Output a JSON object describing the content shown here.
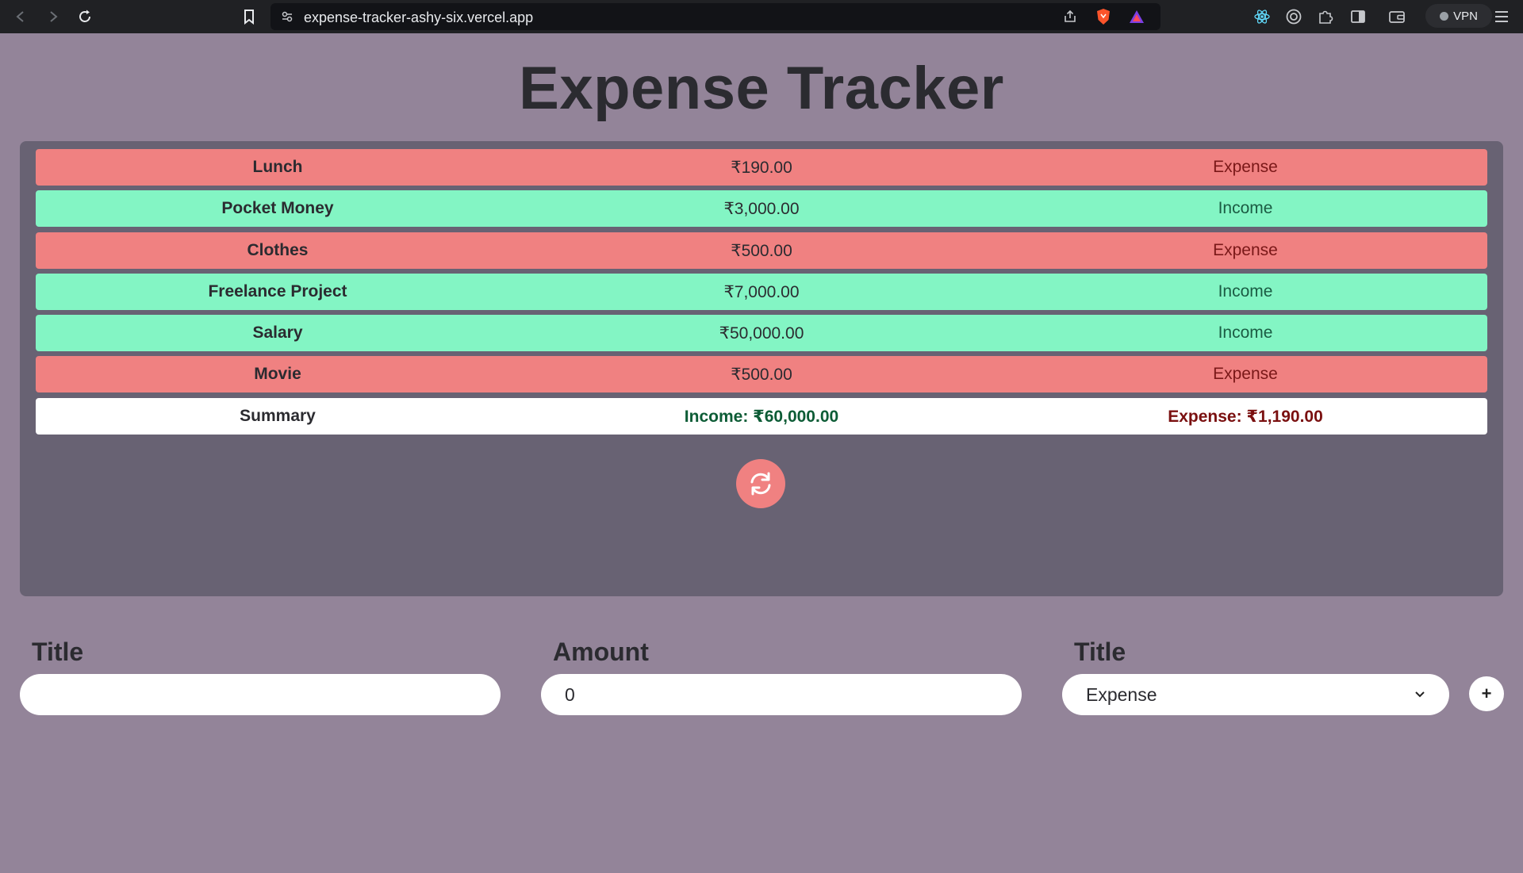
{
  "browser": {
    "url": "expense-tracker-ashy-six.vercel.app",
    "vpn_label": "VPN"
  },
  "app": {
    "title": "Expense Tracker"
  },
  "transactions": [
    {
      "title": "Lunch",
      "amount": "₹190.00",
      "type": "Expense"
    },
    {
      "title": "Pocket Money",
      "amount": "₹3,000.00",
      "type": "Income"
    },
    {
      "title": "Clothes",
      "amount": "₹500.00",
      "type": "Expense"
    },
    {
      "title": "Freelance Project",
      "amount": "₹7,000.00",
      "type": "Income"
    },
    {
      "title": "Salary",
      "amount": "₹50,000.00",
      "type": "Income"
    },
    {
      "title": "Movie",
      "amount": "₹500.00",
      "type": "Expense"
    }
  ],
  "summary": {
    "label": "Summary",
    "income": "Income: ₹60,000.00",
    "expense": "Expense: ₹1,190.00"
  },
  "form": {
    "title_label": "Title",
    "title_value": "",
    "amount_label": "Amount",
    "amount_value": "0",
    "type_label": "Title",
    "type_value": "Expense",
    "add_label": "+"
  },
  "colors": {
    "page_bg": "#938499",
    "panel_bg": "#686273",
    "expense_row": "#f08181",
    "income_row": "#83f5c4",
    "summary_row": "#ffffff"
  }
}
